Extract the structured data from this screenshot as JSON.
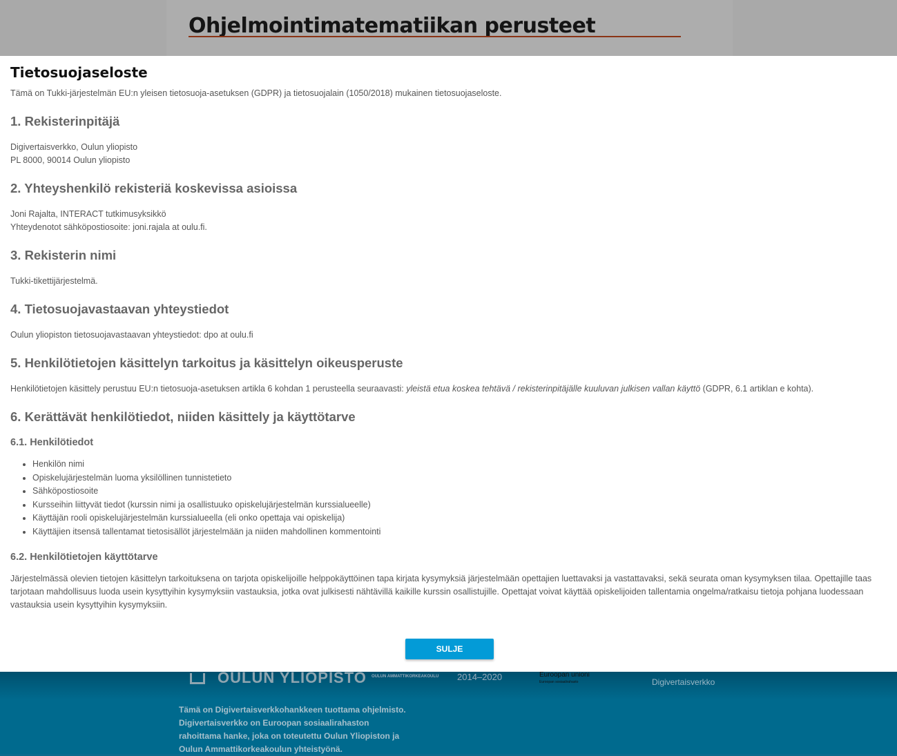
{
  "header": {
    "site_title": "Ohjelmointimatematiikan perusteet"
  },
  "modal": {
    "title": "Tietosuojaseloste",
    "intro": "Tämä on Tukki-järjestelmän EU:n yleisen tietosuoja-asetuksen (GDPR) ja tietosuojalain (1050/2018) mukainen tietosuojaseloste.",
    "s1": {
      "heading": "1. Rekisterinpitäjä",
      "lines": [
        "Digivertaisverkko, Oulun yliopisto",
        "PL 8000, 90014 Oulun yliopisto"
      ]
    },
    "s2": {
      "heading": "2. Yhteyshenkilö rekisteriä koskevissa asioissa",
      "lines": [
        "Joni Rajalta, INTERACT tutkimusyksikkö",
        "Yhteydenotot sähköpostiosoite: joni.rajala at oulu.fi."
      ]
    },
    "s3": {
      "heading": "3. Rekisterin nimi",
      "text": "Tukki-tikettijärjestelmä."
    },
    "s4": {
      "heading": "4. Tietosuojavastaavan yhteystiedot",
      "text": "Oulun yliopiston tietosuojavastaavan yhteystiedot: dpo at oulu.fi"
    },
    "s5": {
      "heading": "5. Henkilötietojen käsittelyn tarkoitus ja käsittelyn oikeusperuste",
      "text_before": "Henkilötietojen käsittely perustuu EU:n tietosuoja-asetuksen artikla 6 kohdan 1 perusteella seuraavasti: ",
      "text_italic": "yleistä etua koskea tehtävä / rekisterinpitäjälle kuuluvan julkisen vallan käyttö",
      "text_after": " (GDPR, 6.1 artiklan e kohta)."
    },
    "s6": {
      "heading": "6. Kerättävät henkilötiedot, niiden käsittely ja käyttötarve",
      "s61": {
        "heading": "6.1. Henkilötiedot",
        "items": [
          "Henkilön nimi",
          "Opiskelujärjestelmän luoma yksilöllinen tunnistetieto",
          "Sähköpostiosoite",
          "Kursseihin liittyvät tiedot (kurssin nimi ja osallistuuko opiskelujärjestelmän kurssialueelle)",
          "Käyttäjän rooli opiskelujärjestelmän kurssialueella (eli onko opettaja vai opiskelija)",
          "Käyttäjien itsensä tallentamat tietosisällöt järjestelmään ja niiden mahdollinen kommentointi"
        ]
      },
      "s62": {
        "heading": "6.2. Henkilötietojen käyttötarve",
        "text": "Järjestelmässä olevien tietojen käsittelyn tarkoituksena on tarjota opiskelijoille helppokäyttöinen tapa kirjata kysymyksiä järjestelmään opettajien luettavaksi ja vastattavaksi, sekä seurata oman kysymyksen tilaa. Opettajille taas tarjotaan mahdollisuus luoda usein kysyttyihin kysymyksiin vastauksia, jotka ovat julkisesti nähtävillä kaikille kurssin osallistujille. Opettajat voivat käyttää opiskelijoiden tallentamia ongelma/ratkaisu tietoja pohjana luodessaan vastauksia usein kysyttyihin kysymyksiin."
      }
    },
    "close_label": "SULJE"
  },
  "footer": {
    "logo_oulu": "OULUN YLIOPISTO",
    "logo_oamk": "OULUN AMMATTIKORKEAKOULU",
    "years": "2014–2020",
    "eu": "Euroopan unioni",
    "eu_sub": "Euroopan sosiaalirahasto",
    "digivertaisverkko": "Digivertaisverkko",
    "text": "Tämä on Digivertaisverkkohankkeen tuottama ohjelmisto. Digivertaisverkko on Euroopan sosiaalirahaston rahoittama hanke, joka on toteutettu Oulun Yliopiston ja Oulun Ammattikorkeakoulun yhteistyönä."
  }
}
